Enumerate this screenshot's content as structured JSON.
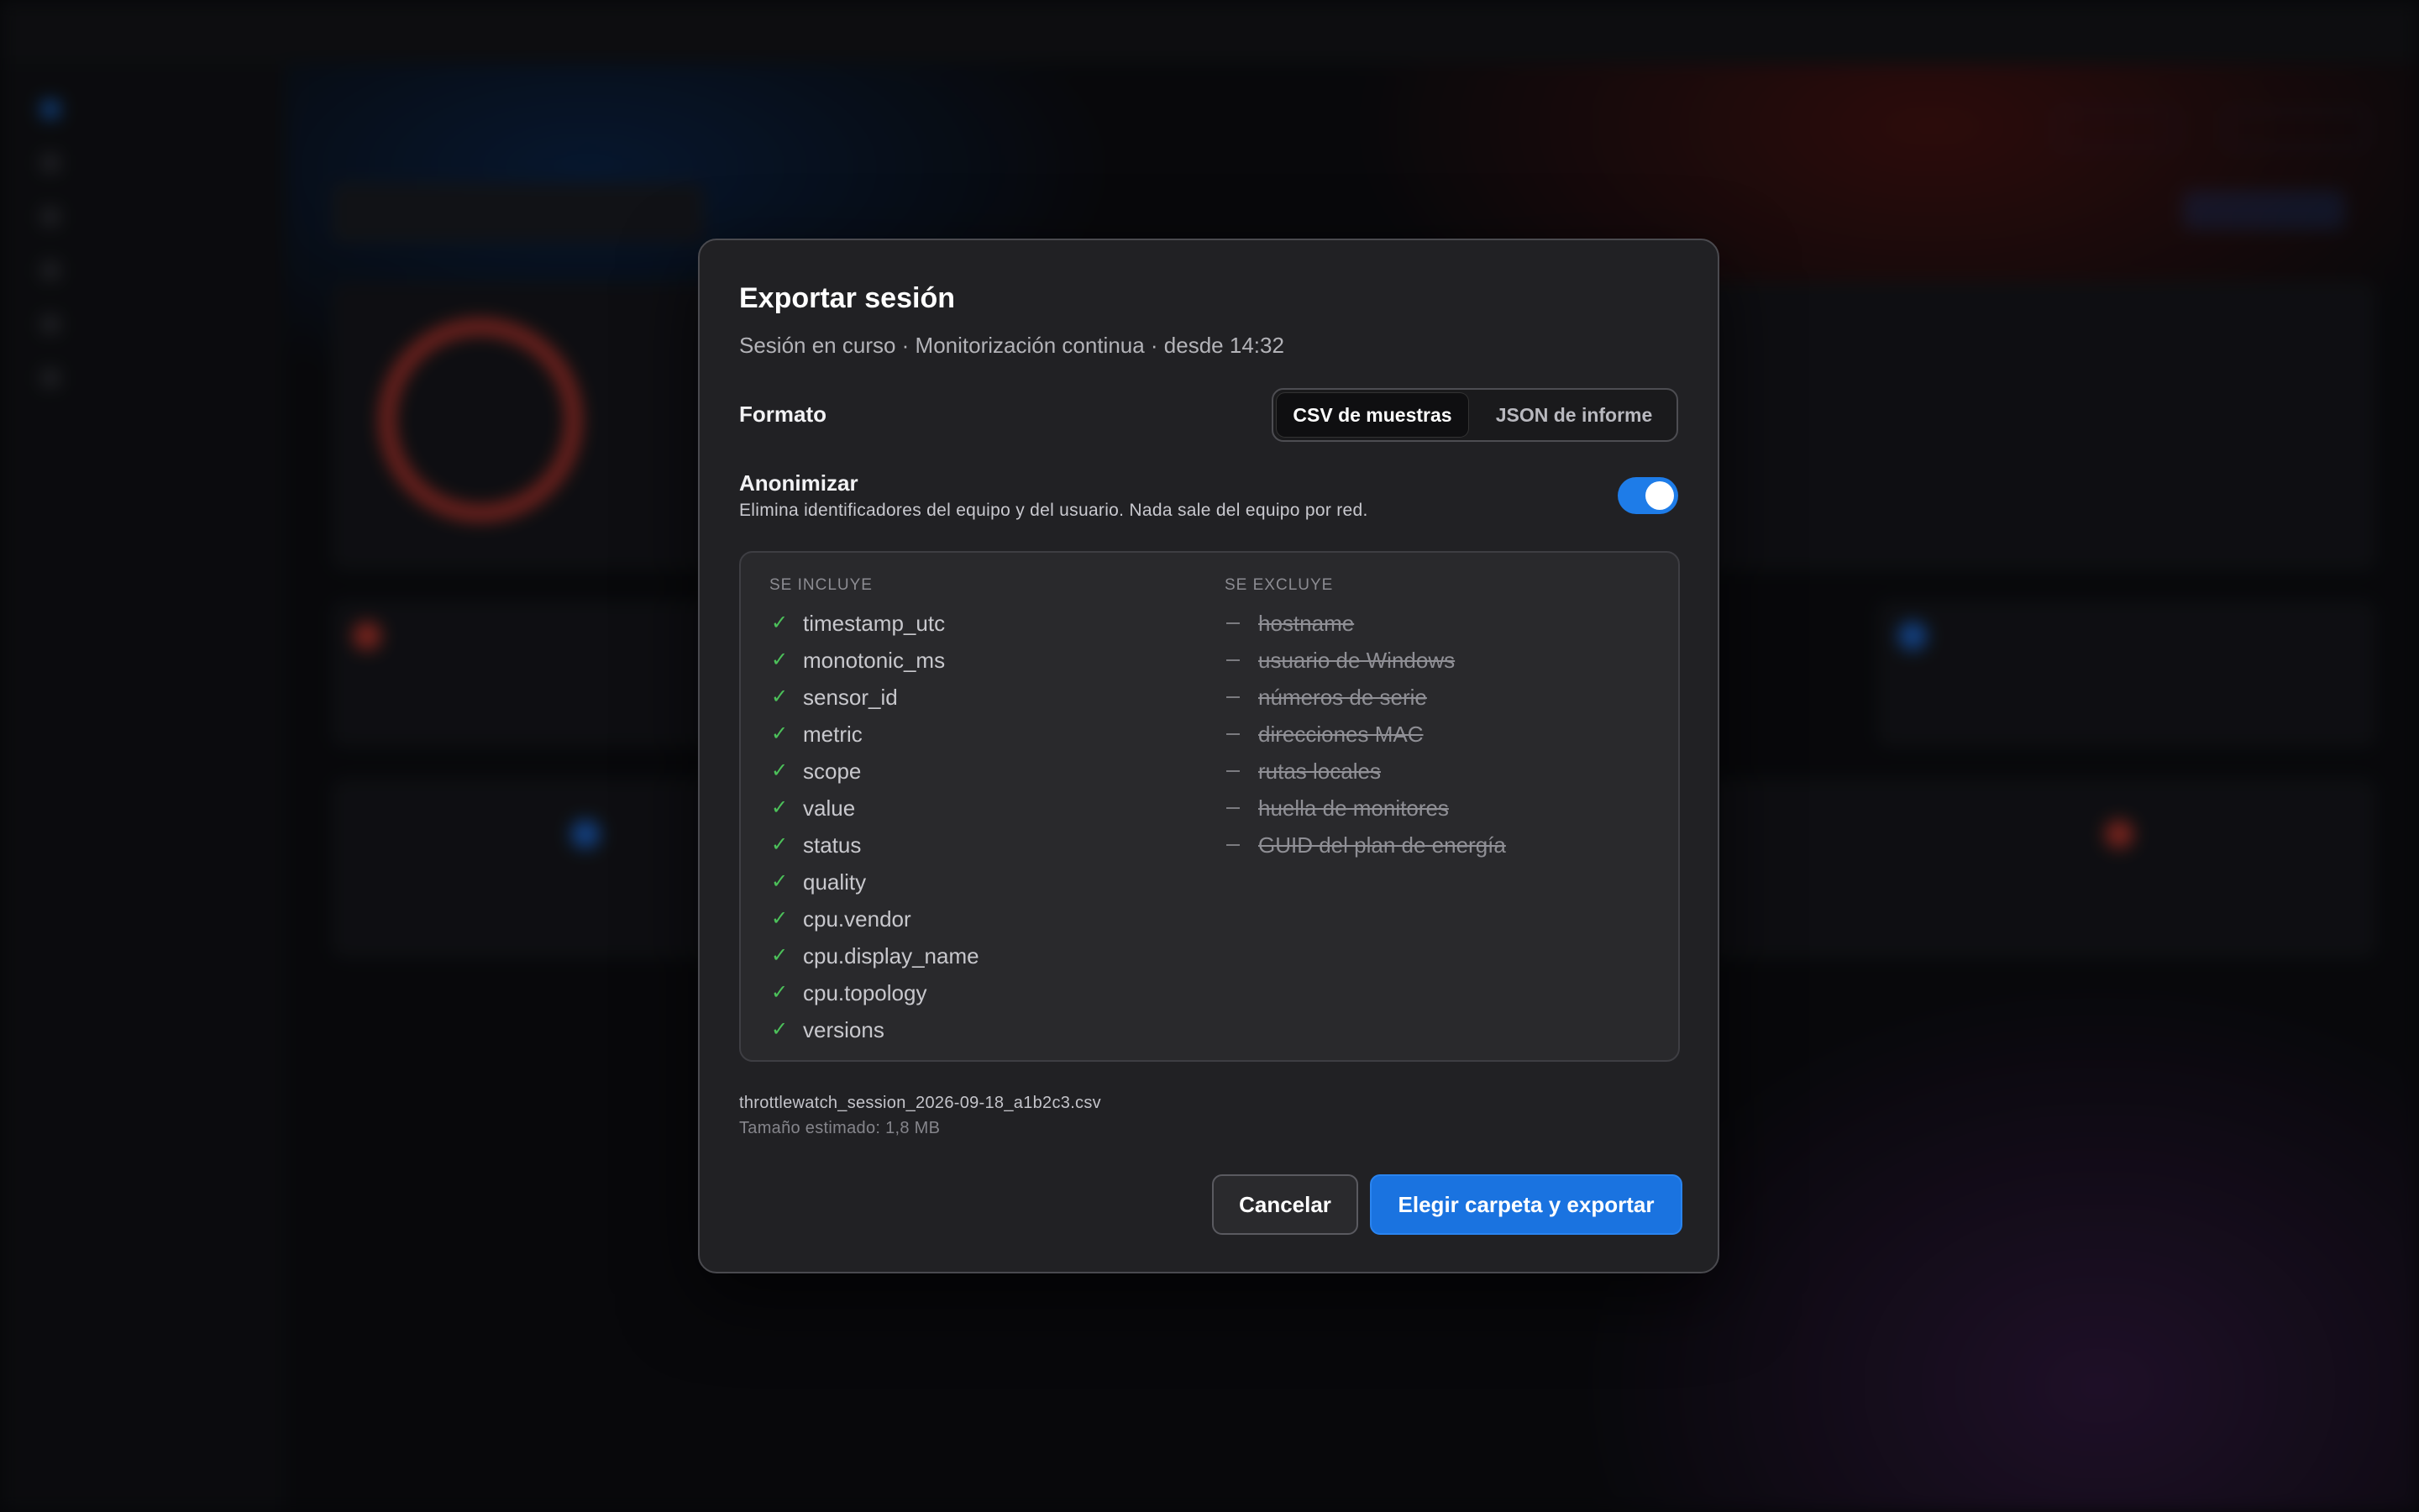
{
  "dialog": {
    "title": "Exportar sesión",
    "subtitle": "Sesión en curso · Monitorización continua · desde 14:32",
    "format": {
      "label": "Formato",
      "options": [
        "CSV de muestras",
        "JSON de informe"
      ],
      "selected": "CSV de muestras"
    },
    "anonymize": {
      "label": "Anonimizar",
      "description": "Elimina identificadores del equipo y del usuario. Nada sale del equipo por red.",
      "enabled": true
    },
    "included": {
      "heading": "SE INCLUYE",
      "items": [
        "timestamp_utc",
        "monotonic_ms",
        "sensor_id",
        "metric",
        "scope",
        "value",
        "status",
        "quality",
        "cpu.vendor",
        "cpu.display_name",
        "cpu.topology",
        "versions"
      ]
    },
    "excluded": {
      "heading": "SE EXCLUYE",
      "items": [
        "hostname",
        "usuario de Windows",
        "números de serie",
        "direcciones MAC",
        "rutas locales",
        "huella de monitores",
        "GUID del plan de energía"
      ]
    },
    "file_name": "throttlewatch_session_2026-09-18_a1b2c3.csv",
    "estimated_size": "Tamaño estimado: 1,8 MB",
    "buttons": {
      "cancel": "Cancelar",
      "export": "Elegir carpeta y exportar"
    }
  },
  "colors": {
    "accent": "#1a73e0",
    "check": "#4cc15a",
    "modal_bg": "#212124"
  },
  "icons": {
    "included_marker": "check-icon",
    "excluded_marker": "dash-icon"
  }
}
